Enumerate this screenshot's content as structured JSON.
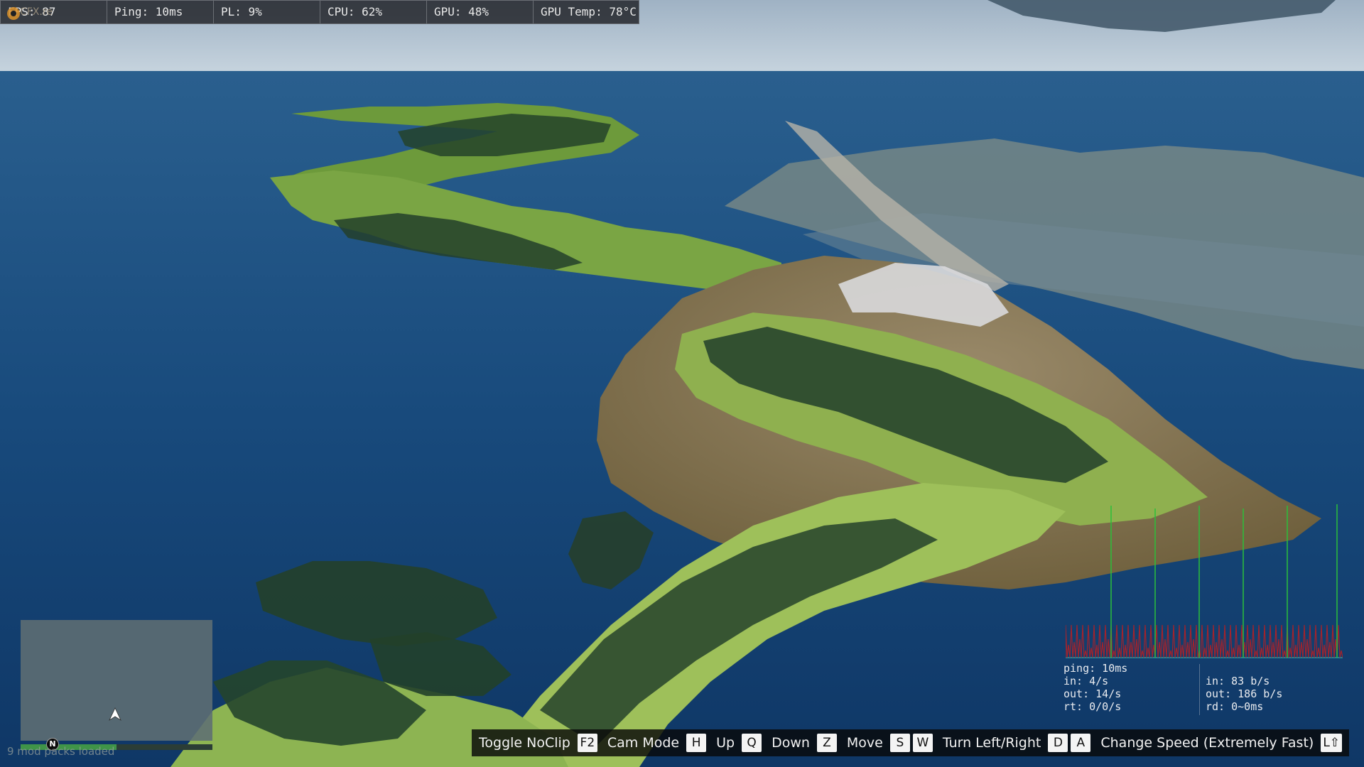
{
  "perf_overlay": {
    "fps": "FPS: 87",
    "ping": "Ping: 10ms",
    "packet_loss": "PL: 9%",
    "cpu": "CPU: 62%",
    "gpu": "GPU: 48%",
    "gpu_temp": "GPU Temp: 78°C"
  },
  "brand": {
    "logo_text": "CFX.re",
    "logo_icon": "cfx-logo-icon"
  },
  "minimap": {
    "compass_label": "N",
    "health_fraction": 0.5,
    "armor_fraction": 0.0,
    "player_icon": "player-arrow-icon"
  },
  "status": {
    "mod_packs": "9 mod packs loaded"
  },
  "netgraph": {
    "ping": "ping: 10ms",
    "in_rate": "in: 4/s",
    "out_rate": "out: 14/s",
    "rt": "rt: 0/0/s",
    "in_bytes": "in: 83 b/s",
    "out_bytes": "out: 186 b/s",
    "rd": "rd: 0~0ms",
    "colors": {
      "incoming": "#2bbf3a",
      "outgoing": "#a3232c",
      "baseline": "#2c9aa0"
    }
  },
  "hints": [
    {
      "label": "Toggle NoClip",
      "keys": [
        "F2"
      ]
    },
    {
      "label": "Cam Mode",
      "keys": [
        "H"
      ]
    },
    {
      "label": "Up",
      "keys": [
        "Q"
      ]
    },
    {
      "label": "Down",
      "keys": [
        "Z"
      ]
    },
    {
      "label": "Move",
      "keys": [
        "S",
        "W"
      ]
    },
    {
      "label": "Turn Left/Right",
      "keys": [
        "D",
        "A"
      ]
    },
    {
      "label": "Change Speed (Extremely Fast)",
      "keys": [
        "L⇧"
      ]
    }
  ]
}
